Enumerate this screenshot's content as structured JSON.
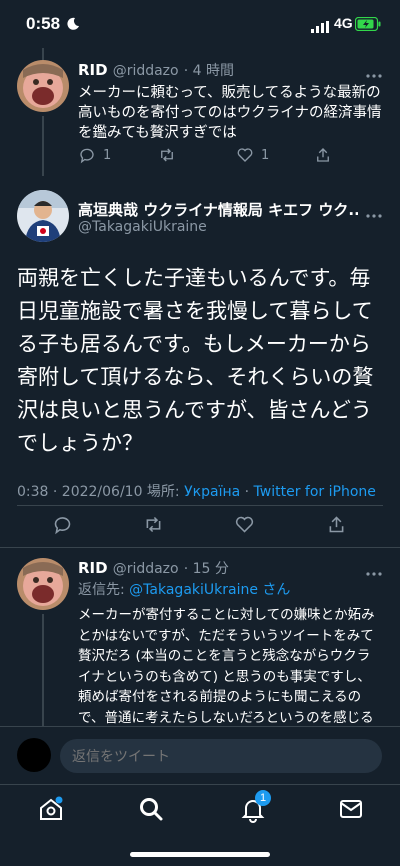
{
  "status_bar": {
    "time": "0:58",
    "network": "4G"
  },
  "parent_tweet": {
    "name": "RID",
    "handle": "@riddazo",
    "time": "· 4 時間",
    "text": "メーカーに頼むって、販売してるような最新の高いものを寄付ってのはウクライナの経済事情を鑑みても贅沢すぎでは",
    "reply_count": "1",
    "retweet_count": "",
    "like_count": "1"
  },
  "main_tweet": {
    "name": "高垣典哉 ウクライナ情報局 キエフ ウク...",
    "handle": "@TakagakiUkraine",
    "text": "両親を亡くした子達もいるんです。毎日児童施設で暑さを我慢して暮らしてる子も居るんです。もしメーカーから寄附して頂けるなら、それくらいの贅沢は良いと思うんですが、皆さんどうでしょうか？",
    "meta_time": "0:38 · 2022/06/10 場所: ",
    "meta_place": "Україна",
    "meta_sep": " · ",
    "meta_source": "Twitter for iPhone"
  },
  "reply_tweet": {
    "name": "RID",
    "handle": "@riddazo",
    "time": "· 15 分",
    "replying_prefix": "返信先: ",
    "replying_to": "@TakagakiUkraine",
    "replying_suffix": " さん",
    "text": "メーカーが寄付することに対しての嫌味とか妬みとかはないですが、ただそういうツイートをみて贅沢だろ (本当のことを言うと残念ながらウクライナというのも含めて) と思うのも事実ですし、頼めば寄付をされる前提のようにも聞こえるので、普通に考えたらしないだろというのを感じるのも事実です"
  },
  "reply_bar": {
    "placeholder": "返信をツイート"
  },
  "tabbar": {
    "notifications_badge": "1"
  },
  "colors": {
    "background": "#15202b",
    "accent": "#1d9bf0",
    "muted": "#8b98a5",
    "divider": "#38444d"
  }
}
